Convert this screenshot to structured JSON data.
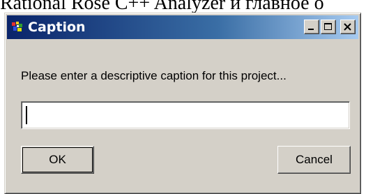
{
  "document": {
    "text": "Rational Rose C++ Analyzer и главное о"
  },
  "window": {
    "title": "Caption",
    "icon": "rational-rose-app-icon",
    "controls": {
      "minimize_icon": "minimize-icon",
      "maximize_icon": "maximize-icon",
      "close_icon": "close-icon"
    }
  },
  "dialog": {
    "prompt": "Please enter a descriptive caption for this project...",
    "caption_input": {
      "value": "",
      "placeholder": ""
    },
    "ok_label": "OK",
    "cancel_label": "Cancel"
  },
  "colors": {
    "titlebar_start": "#0a246a",
    "titlebar_end": "#a6caf0",
    "face": "#d4d0c8"
  }
}
